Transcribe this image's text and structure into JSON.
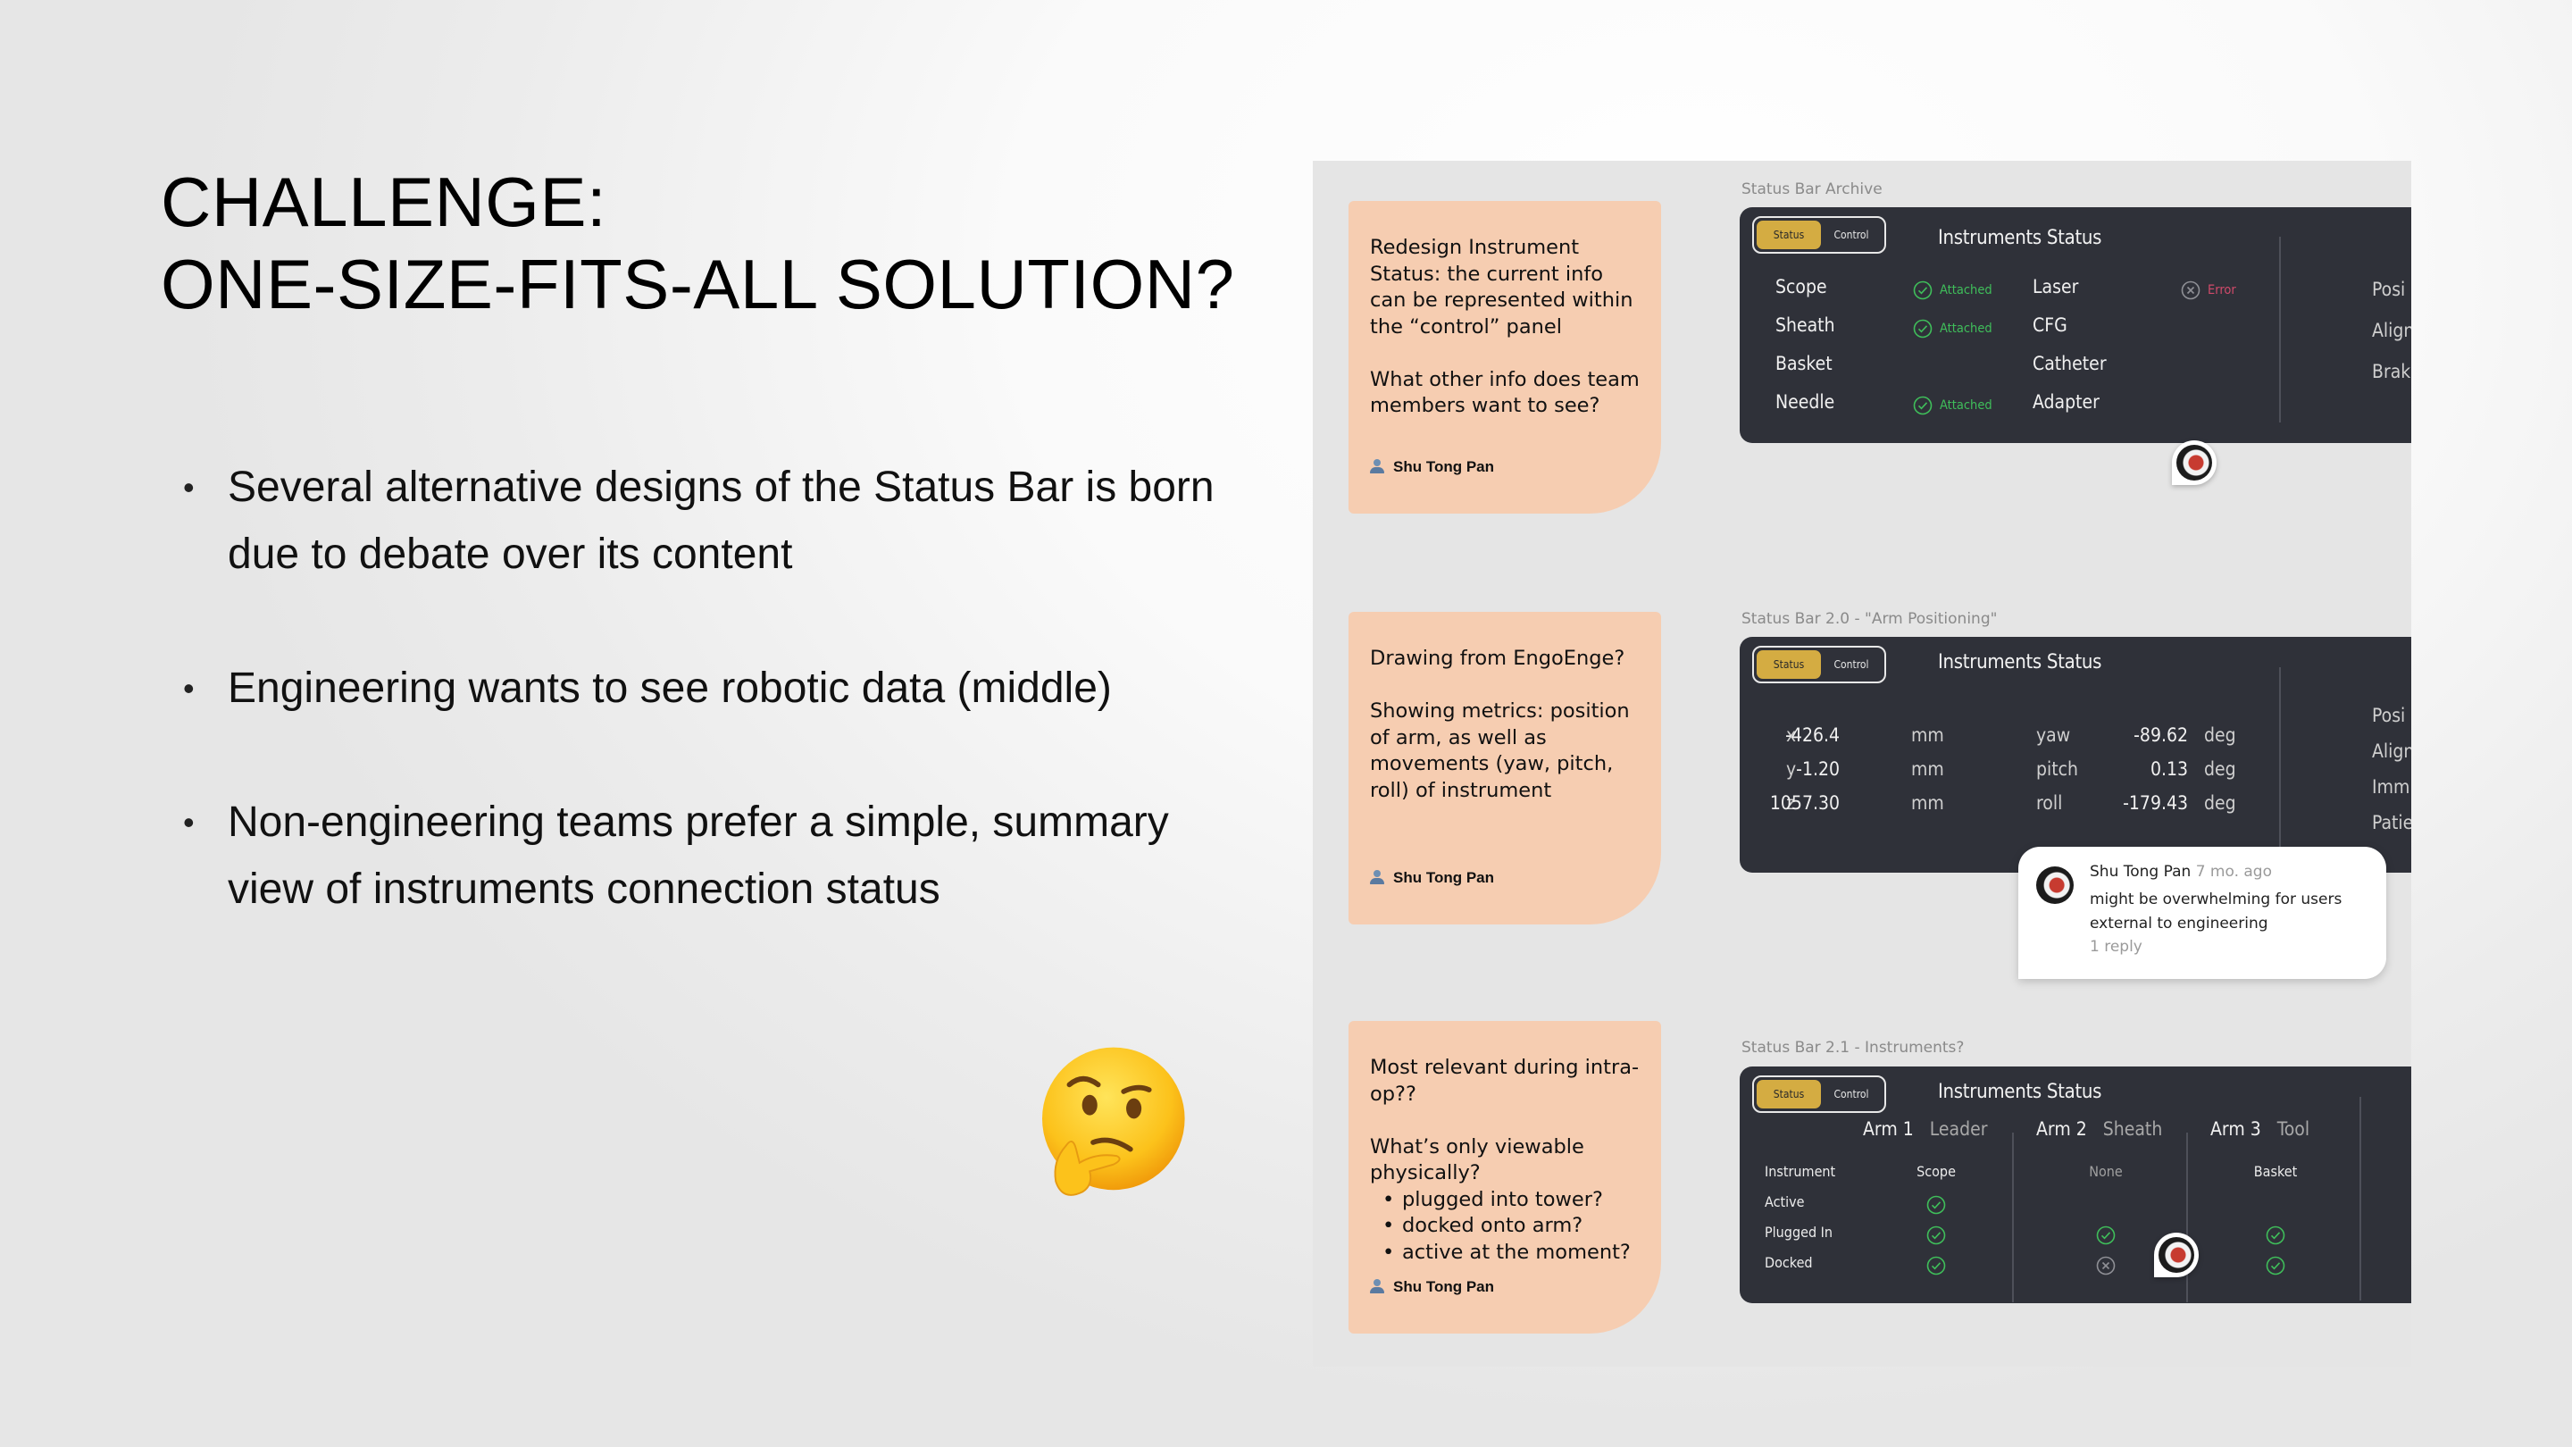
{
  "slide": {
    "title_lines": [
      "CHALLENGE:",
      "ONE-SIZE-FITS-ALL SOLUTION?"
    ],
    "bullets": [
      "Several alternative designs of the Status Bar is born due to debate over its content",
      "Engineering wants to see robotic data (middle)",
      "Non-engineering teams prefer a simple, summary view of instruments connection status"
    ],
    "emoji": "thinking-face"
  },
  "stickies": [
    {
      "text": "Redesign Instrument Status: the current info can be represented within the “control” panel\n\nWhat other info does team members want to see?",
      "author": "Shu Tong Pan"
    },
    {
      "text": "Drawing from EngoEnge?\n\nShowing metrics: position of arm, as well as movements (yaw, pitch, roll) of instrument",
      "author": "Shu Tong Pan"
    },
    {
      "text": "Most relevant during intra-op??\n\nWhat’s only viewable physically?",
      "list": [
        "plugged into tower?",
        "docked onto arm?",
        "active at the moment?"
      ],
      "author": "Shu Tong Pan"
    }
  ],
  "segmented": {
    "status": "Status",
    "control": "Control",
    "selected": "Status"
  },
  "panel_title": "Instruments Status",
  "frames": {
    "archive": {
      "label": "Status Bar Archive",
      "rows_left": [
        {
          "name": "Scope",
          "status": "Attached"
        },
        {
          "name": "Sheath",
          "status": "Attached"
        },
        {
          "name": "Basket",
          "status": ""
        },
        {
          "name": "Needle",
          "status": "Attached"
        }
      ],
      "rows_right": [
        {
          "name": "Laser",
          "status": "Error"
        },
        {
          "name": "CFG",
          "status": ""
        },
        {
          "name": "Catheter",
          "status": ""
        },
        {
          "name": "Adapter",
          "status": ""
        }
      ],
      "side_labels": [
        "Posi",
        "Align",
        "Brak"
      ]
    },
    "arm_positioning": {
      "label": "Status Bar 2.0 - \"Arm Positioning\"",
      "position": [
        {
          "axis": "x",
          "value": "-426.4",
          "unit": "mm"
        },
        {
          "axis": "y",
          "value": "-1.20",
          "unit": "mm"
        },
        {
          "axis": "z",
          "value": "1057.30",
          "unit": "mm"
        }
      ],
      "rotation": [
        {
          "axis": "yaw",
          "value": "-89.62",
          "unit": "deg"
        },
        {
          "axis": "pitch",
          "value": "0.13",
          "unit": "deg"
        },
        {
          "axis": "roll",
          "value": "-179.43",
          "unit": "deg"
        }
      ],
      "side_labels": [
        "Posi",
        "Align",
        "Imm",
        "Patie"
      ],
      "comment": {
        "author": "Shu Tong Pan",
        "time": "7 mo. ago",
        "body": "might be overwhelming for users external to engineering",
        "replies": "1 reply"
      }
    },
    "instruments": {
      "label": "Status Bar 2.1 - Instruments?",
      "row_labels": [
        "Instrument",
        "Active",
        "Plugged In",
        "Docked"
      ],
      "arms": [
        {
          "arm": "Arm 1",
          "role": "Leader",
          "instrument": "Scope",
          "active": "ok",
          "plugged_in": "ok",
          "docked": "ok"
        },
        {
          "arm": "Arm 2",
          "role": "Sheath",
          "instrument": "None",
          "active": "",
          "plugged_in": "ok",
          "docked": "error"
        },
        {
          "arm": "Arm 3",
          "role": "Tool",
          "instrument": "Basket",
          "active": "",
          "plugged_in": "ok",
          "docked": "ok"
        }
      ]
    }
  },
  "colors": {
    "sticky": "#f6cdb1",
    "panel": "#2f3139",
    "accent": "#d4ac42",
    "ok": "#3fbe5a",
    "error": "#d04a6a"
  }
}
